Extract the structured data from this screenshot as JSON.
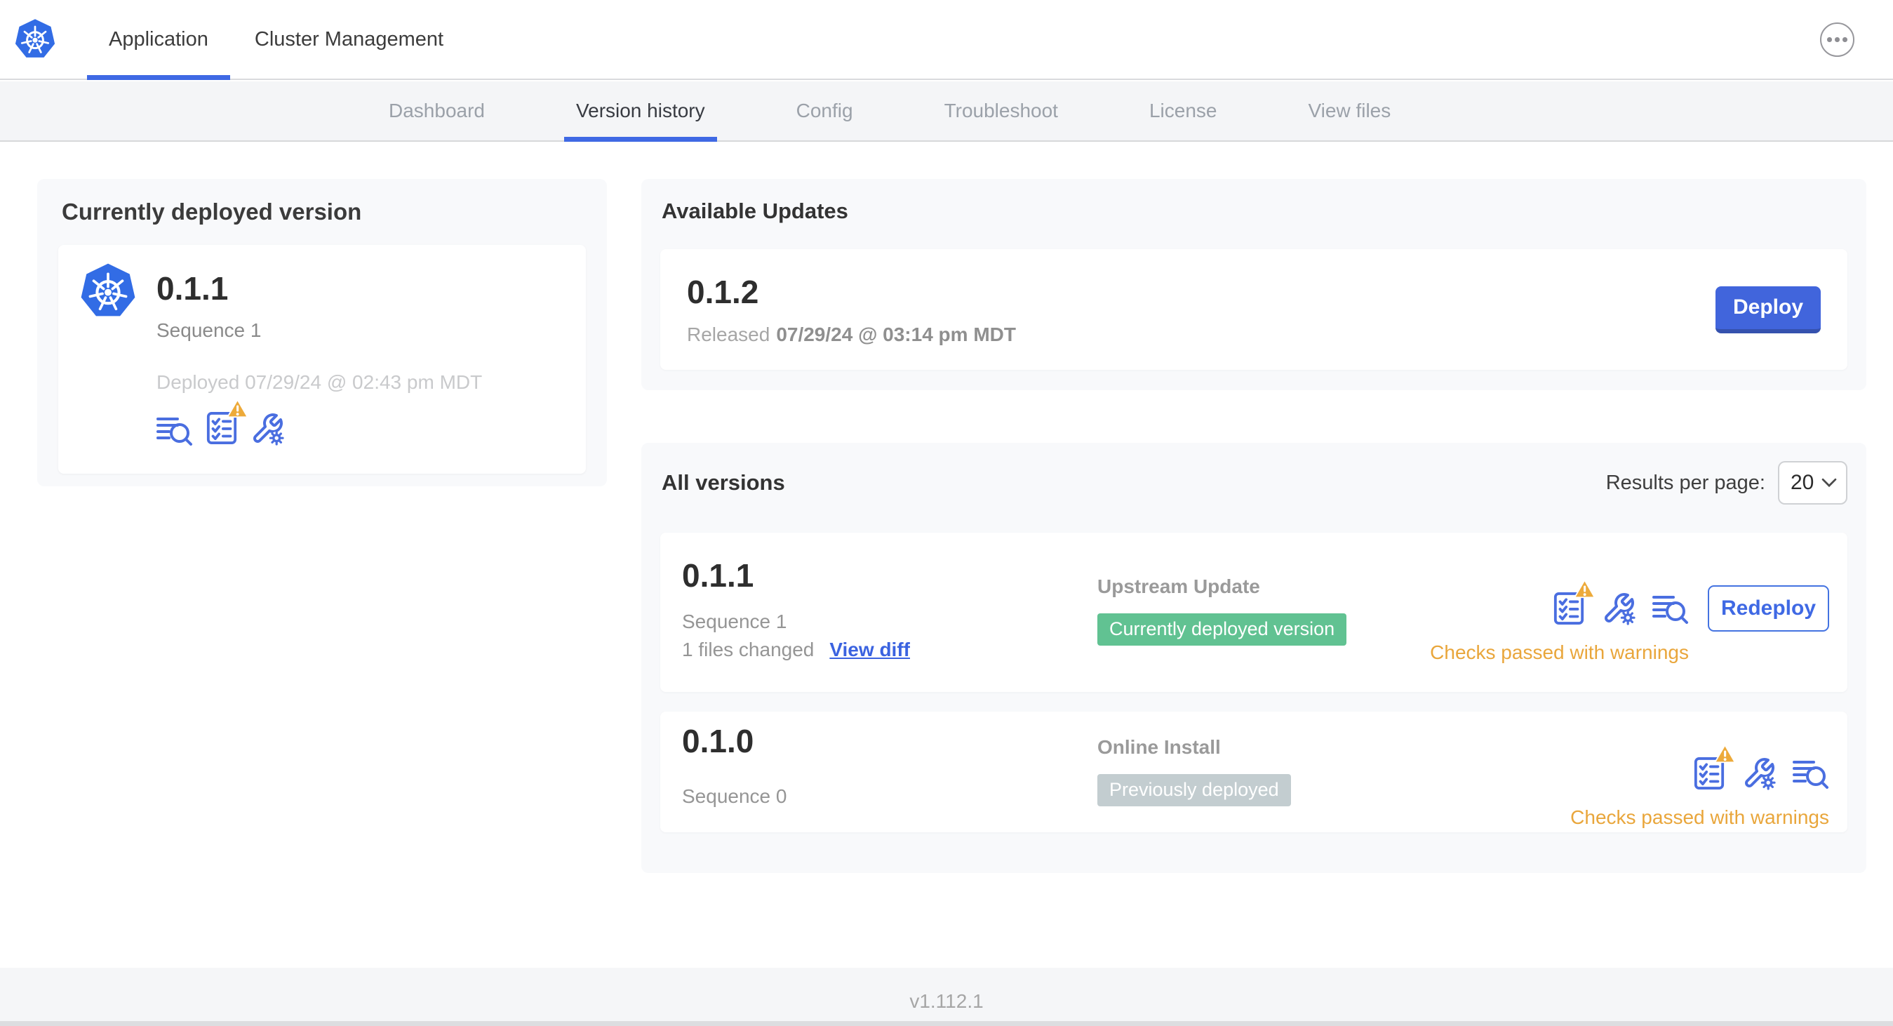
{
  "header": {
    "tabs": [
      {
        "label": "Application"
      },
      {
        "label": "Cluster Management"
      }
    ]
  },
  "subnav": {
    "tabs": [
      "Dashboard",
      "Version history",
      "Config",
      "Troubleshoot",
      "License",
      "View files"
    ]
  },
  "current_version": {
    "title": "Currently deployed version",
    "version": "0.1.1",
    "sequence": "Sequence 1",
    "deployed": "Deployed 07/29/24 @ 02:43 pm MDT"
  },
  "available_updates": {
    "title": "Available Updates",
    "version": "0.1.2",
    "released_prefix": "Released",
    "released_date": "07/29/24 @ 03:14 pm MDT",
    "deploy_label": "Deploy"
  },
  "all_versions": {
    "title": "All versions",
    "results_per_page_label": "Results per page:",
    "results_per_page_value": "20",
    "items": [
      {
        "version": "0.1.1",
        "sequence": "Sequence 1",
        "files_changed": "1 files changed",
        "view_diff_label": "View diff",
        "source": "Upstream Update",
        "badge": "Currently deployed version",
        "action_label": "Redeploy",
        "status": "Checks passed with warnings"
      },
      {
        "version": "0.1.0",
        "sequence": "Sequence 0",
        "source": "Online Install",
        "badge": "Previously deployed",
        "status": "Checks passed with warnings"
      }
    ]
  },
  "footer": {
    "app_version": "v1.112.1"
  },
  "colors": {
    "accent_blue": "#3f69e4",
    "kubernetes_blue": "#326ce5",
    "icon_blue": "#4a6ee0",
    "button_blue": "#4165dc",
    "warning_amber": "#e9a63b",
    "badge_green": "#61c292",
    "badge_gray": "#c3cdd0",
    "subnav_bg": "#f4f5f7",
    "card_bg": "#f8f9fb"
  }
}
